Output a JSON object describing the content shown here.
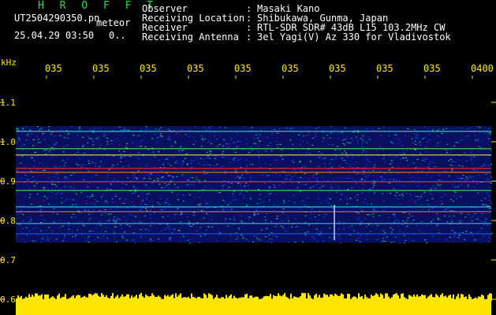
{
  "header": {
    "station": "H R O F F T",
    "file_name": "UT2504290350.pn",
    "meteor_label": "meteor",
    "date_time": "25.04.29 03:50",
    "count": "0.."
  },
  "info": {
    "rows": [
      {
        "key": "Observer",
        "value": "Masaki Kano"
      },
      {
        "key": "Receiving Location",
        "value": "Shibukawa, Gunma, Japan"
      },
      {
        "key": "Receiver",
        "value": "RTL-SDR SDR# 43dB L15 103.2MHz CW"
      },
      {
        "key": "Receiving Antenna",
        "value": "3el Yagi(V) Az 330 for Vladivostok"
      }
    ],
    "separator": ":"
  },
  "axis": {
    "unit": "kHz",
    "y_labels": [
      "1.1",
      "1.0",
      "0.9",
      "0.8",
      "0.7",
      "0.6"
    ],
    "time_ticks": [
      "035",
      "035",
      "035",
      "035",
      "035",
      "035",
      "035",
      "035",
      "035",
      "0400"
    ]
  },
  "colors": {
    "background": "#000000",
    "green_text": "#20e040",
    "white_text": "#ffffff",
    "yellow_text": "#ffe600",
    "signal_blue": "#1030c0",
    "signal_red": "#ff2020"
  }
}
